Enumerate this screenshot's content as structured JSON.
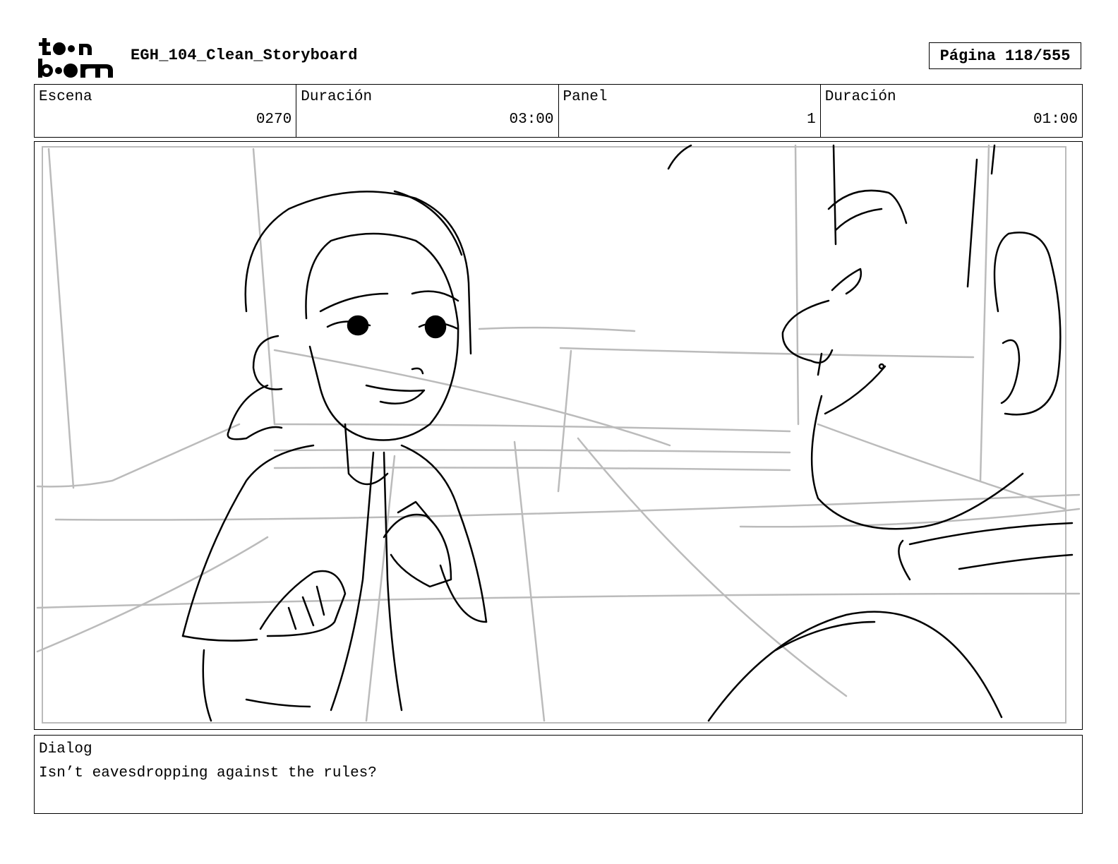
{
  "header": {
    "brand": "toon boom",
    "brand_line1": "toon",
    "brand_line2": "boom",
    "title": "EGH_104_Clean_Storyboard",
    "page_label": "Página 118/555"
  },
  "info": [
    {
      "label": "Escena",
      "value": "0270"
    },
    {
      "label": "Duración",
      "value": "03:00"
    },
    {
      "label": "Panel",
      "value": "1"
    },
    {
      "label": "Duración",
      "value": "01:00"
    }
  ],
  "dialog": {
    "label": "Dialog",
    "text": "Isn’t eavesdropping against the rules?"
  },
  "colors": {
    "ink": "#000000",
    "guide": "#bbbbbb"
  }
}
